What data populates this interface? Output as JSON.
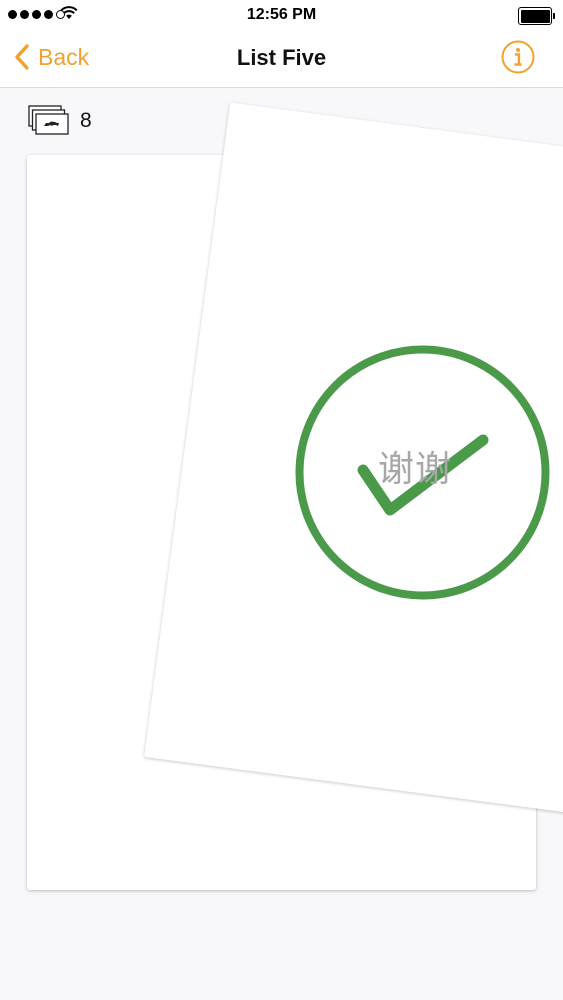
{
  "status_bar": {
    "time": "12:56 PM",
    "signal_bars": 5,
    "signal_filled": 4
  },
  "nav": {
    "back_label": "Back",
    "title": "List Five",
    "info_icon": "info-circle-icon"
  },
  "deck": {
    "icon": "cards-stack-icon",
    "count": "8"
  },
  "card": {
    "word": "谢谢",
    "result_icon": "checkmark-circle-icon"
  },
  "colors": {
    "accent": "#f0a22c",
    "success": "#4a9a4a",
    "background": "#f8f7fa",
    "card": "#ffffff",
    "word": "#a7a7a7"
  }
}
